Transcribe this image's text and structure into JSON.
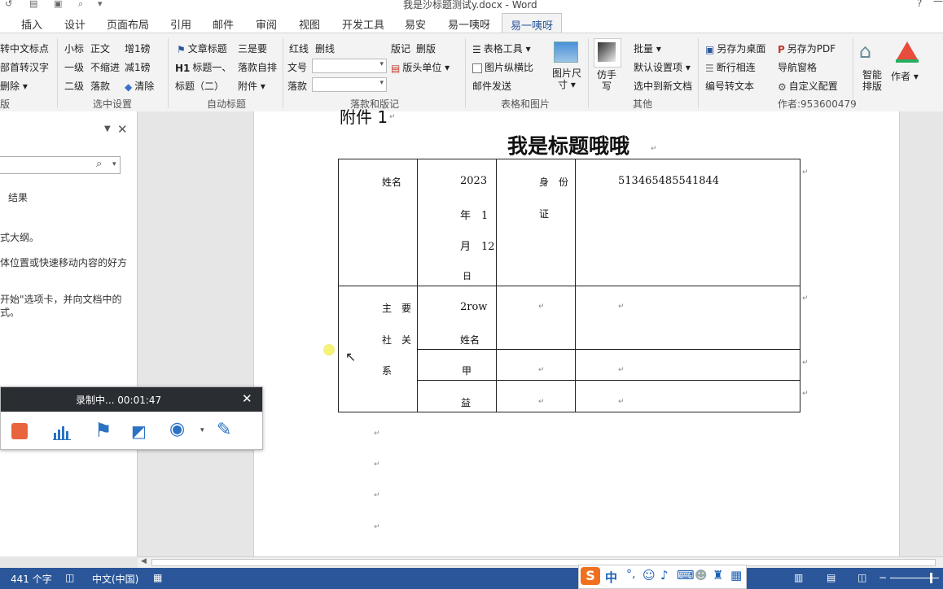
{
  "window": {
    "title": "我是沙标题测试y.docx - Word",
    "help": "?",
    "minimize": "—"
  },
  "tabs": [
    "插入",
    "设计",
    "页面布局",
    "引用",
    "邮件",
    "审阅",
    "视图",
    "开发工具",
    "易安",
    "易一咦呀",
    "易一咦呀"
  ],
  "ribbon": {
    "g1": {
      "i1": "转中文标点",
      "i2": "部首转汉字",
      "i3": "删除",
      "label": "版"
    },
    "g2": {
      "a1": "小标",
      "a2": "一级",
      "a3": "二级",
      "b1": "正文",
      "b2": "不缩进",
      "b3": "落款",
      "c1": "增1磅",
      "c2": "减1磅",
      "c3": "清除",
      "label": "选中设置"
    },
    "g3": {
      "a1": "文章标题",
      "a2": "标题一、",
      "a3": "标题（二）",
      "b1": "三是要",
      "b2": "落款自排",
      "b3": "附件",
      "label": "自动标题"
    },
    "g4": {
      "a1": "红线",
      "a2": "删线",
      "b1": "文号",
      "c1": "落款",
      "d1": "版记",
      "d2": "删版",
      "d3": "版头单位",
      "label": "落款和版记"
    },
    "g5": {
      "a1": "表格工具",
      "a2": "图片纵横比",
      "a3": "邮件发送",
      "b1": "图片尺寸",
      "label": "表格和图片"
    },
    "g6": {
      "big": "仿手写",
      "a1": "批量",
      "a2": "默认设置项",
      "a3": "选中到新文档",
      "label": "其他"
    },
    "g7": {
      "a1": "另存为桌面",
      "a2": "断行相连",
      "a3": "编号转文本",
      "b1": "另存为PDF",
      "b2": "导航窗格",
      "b3": "自定义配置",
      "author": "作者:953600479"
    },
    "g8": {
      "s1": "智能排版",
      "s2": "作者"
    }
  },
  "navpane": {
    "results": "结果",
    "line1": "式大纲。",
    "line2": "体位置或快速移动内容的好方",
    "line3": "开始\"选项卡，并向文档中的",
    "line4": "式。"
  },
  "document": {
    "attachment": "附件 1",
    "title": "我是标题哦哦",
    "table": {
      "r1_name": "姓名",
      "r1_date_1": "2023",
      "r1_date_2": "年　1",
      "r1_date_3": "月　12",
      "r1_date_4": "日",
      "r1_id_1": "身　份",
      "r1_id_2": "证",
      "r1_idnum": "513465485541844",
      "r2_main_1": "主　要",
      "r2_main_2": "社　关",
      "r2_main_3": "系",
      "r2_row": "2row",
      "r2_name": "姓名",
      "r3_a": "甲",
      "r4_a": "益"
    },
    "para_mark": "↵"
  },
  "recorder": {
    "title": "录制中... 00:01:47"
  },
  "status": {
    "words": "441 个字",
    "lang": "中文(中国)",
    "ime": "中"
  }
}
